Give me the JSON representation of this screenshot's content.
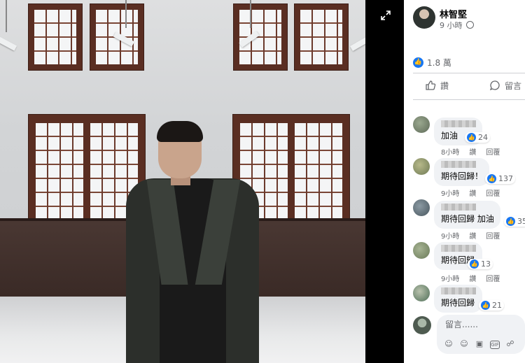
{
  "viewer": {
    "expand_icon": "expand-arrows-icon"
  },
  "post": {
    "author": "林智堅",
    "time": "9 小時",
    "privacy_icon": "globe-icon",
    "reaction_count": "1.8 萬",
    "like_label": "讚",
    "comment_label": "留言"
  },
  "comments": [
    {
      "text": "加油",
      "likes": "24",
      "time": "8小時",
      "like": "讚",
      "reply": "回覆"
    },
    {
      "text": "期待回歸！",
      "likes": "137",
      "time": "9小時",
      "like": "讚",
      "reply": "回覆"
    },
    {
      "text": "期待回歸 加油",
      "likes": "35",
      "time": "9小時",
      "like": "讚",
      "reply": "回覆"
    },
    {
      "text": "期待回歸",
      "likes": "13",
      "time": "9小時",
      "like": "讚",
      "reply": "回覆"
    },
    {
      "text": "期待回歸",
      "likes": "21",
      "time": "",
      "like": "",
      "reply": ""
    }
  ],
  "composer": {
    "placeholder": "留言......",
    "tools": [
      "sticker-icon",
      "emoji-icon",
      "camera-icon",
      "gif-icon",
      "more-sticker-icon"
    ]
  },
  "colors": {
    "like_blue": "#1877f2",
    "secondary_text": "#65676b",
    "bubble_bg": "#f0f2f5"
  }
}
